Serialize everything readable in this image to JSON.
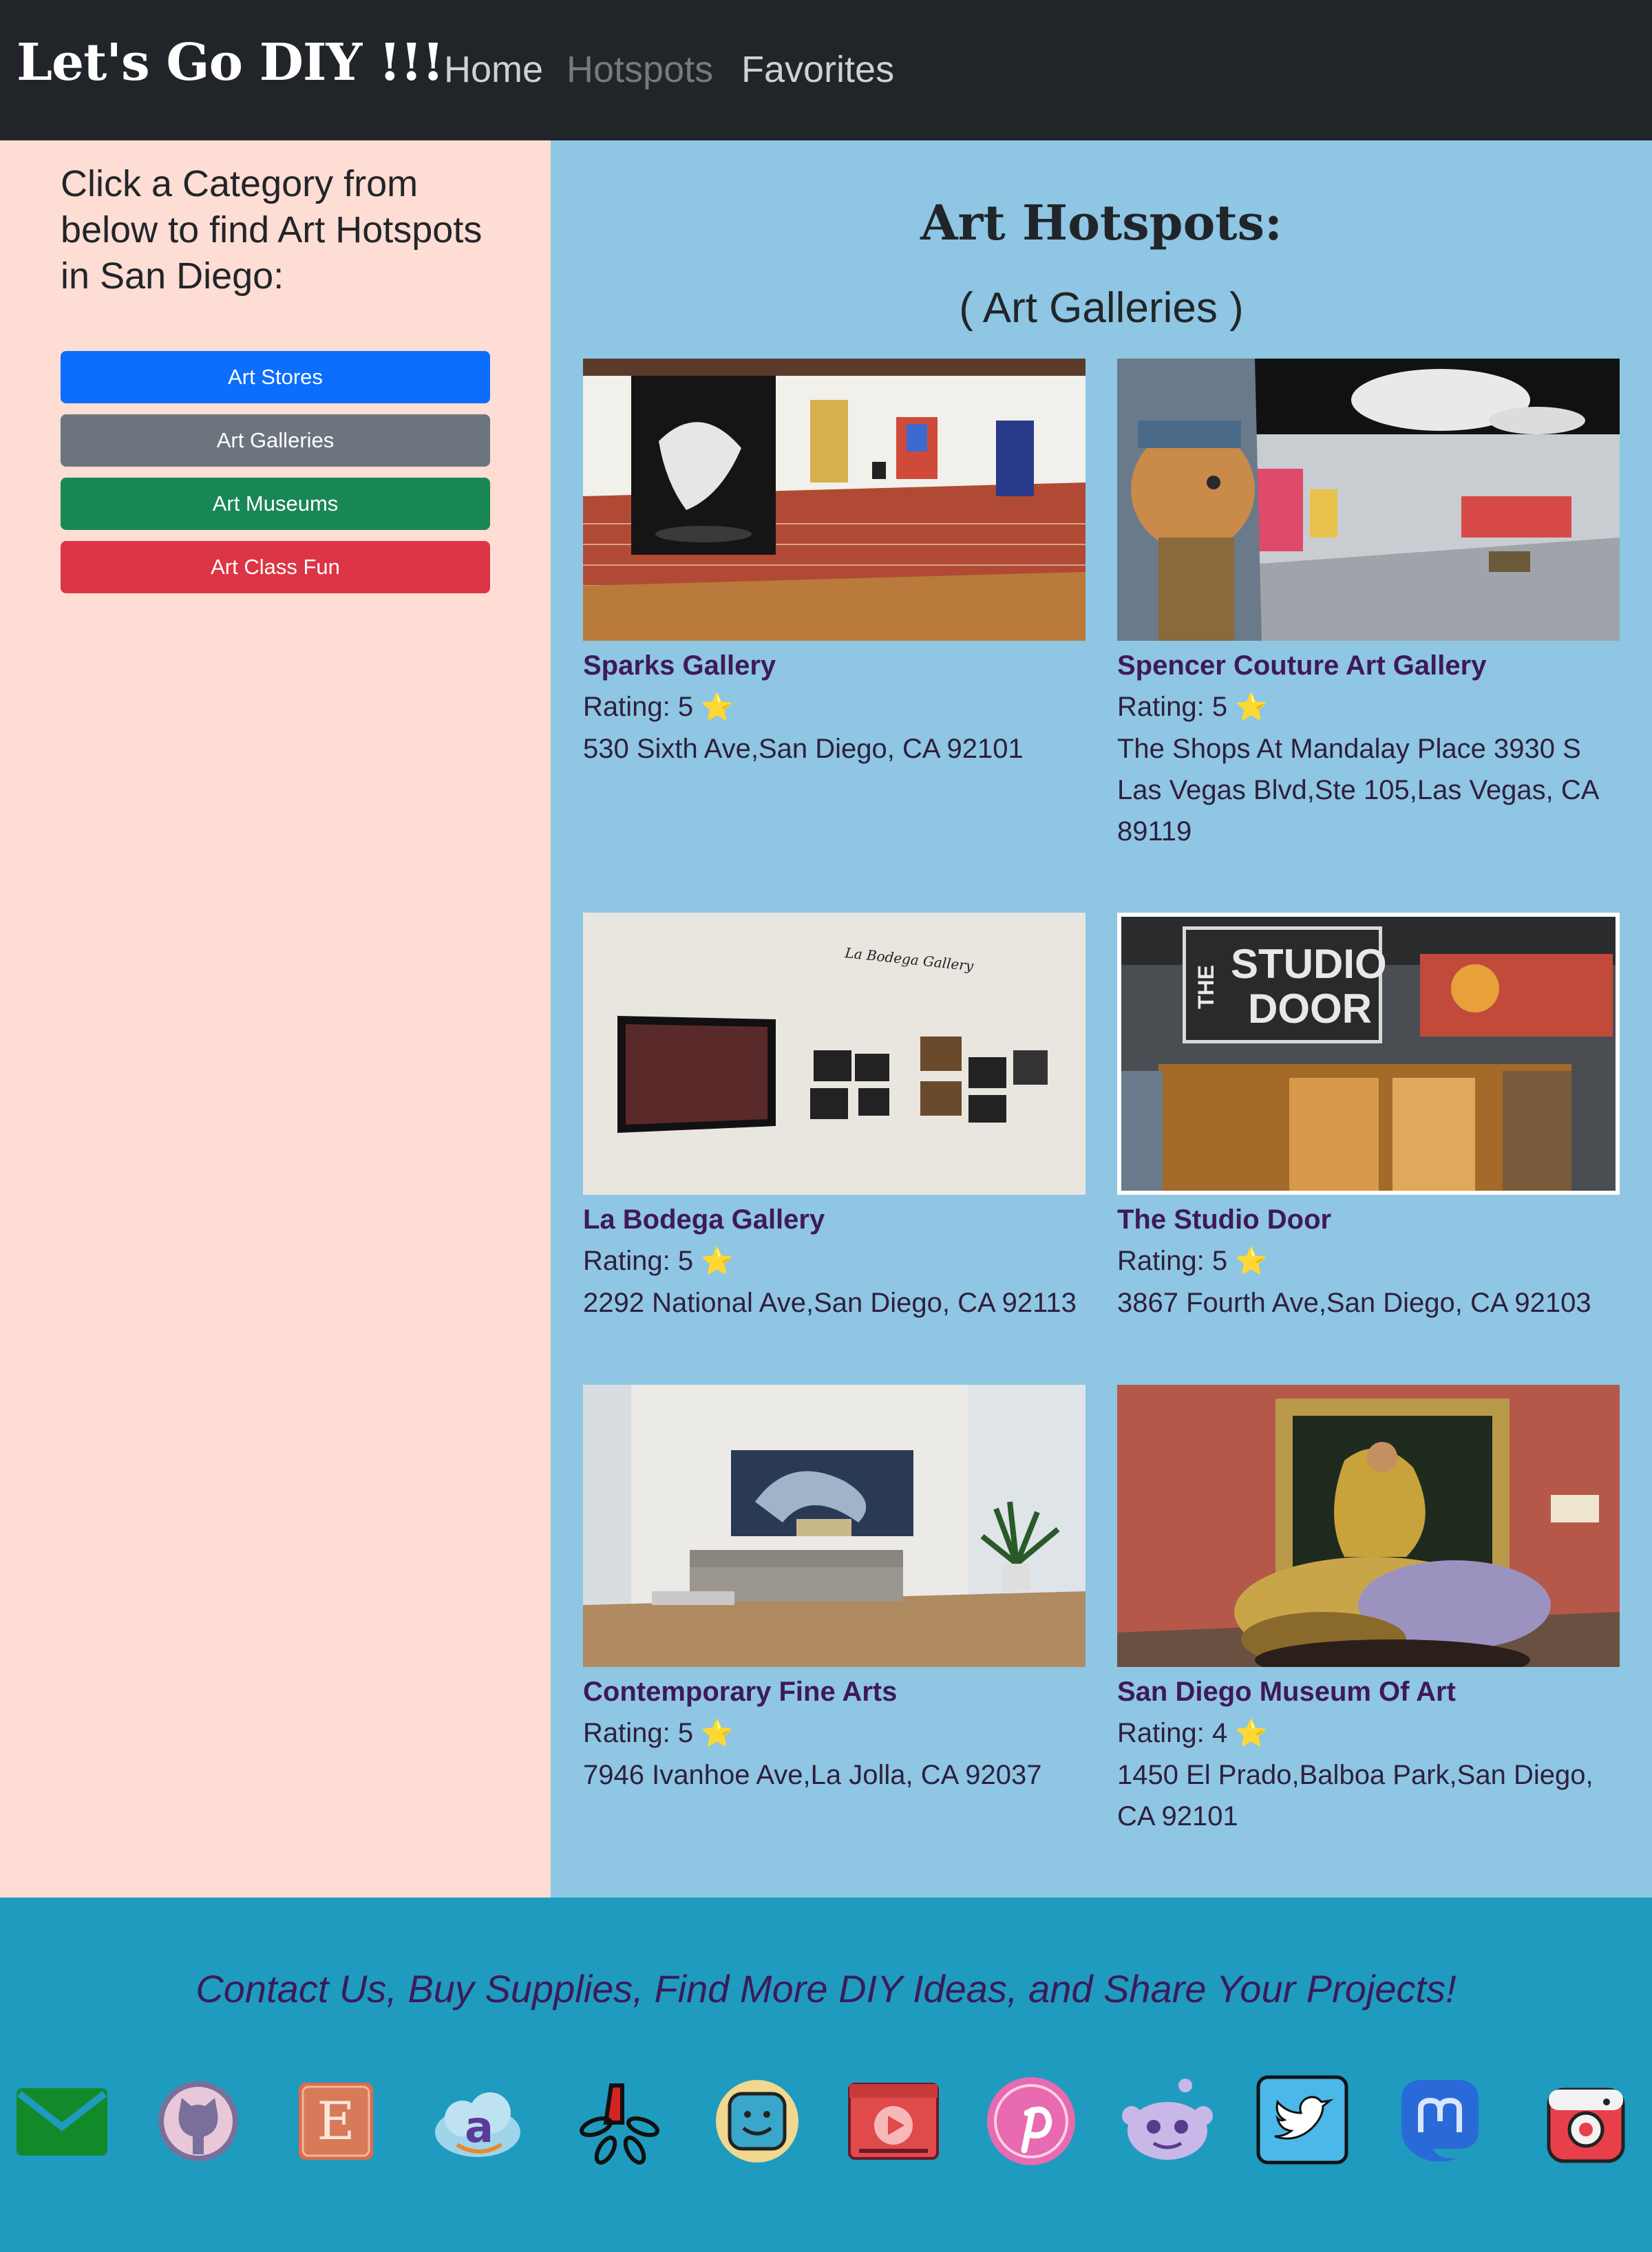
{
  "nav": {
    "brand": "Let's Go DIY !!!",
    "links": [
      "Home",
      "Hotspots",
      "Favorites"
    ]
  },
  "sidebar": {
    "heading": "Click a Category from below to find Art Hotspots in San Diego:",
    "buttons": [
      {
        "label": "Art Stores",
        "color": "#0d6efd"
      },
      {
        "label": "Art Galleries",
        "color": "#6c757d"
      },
      {
        "label": "Art Museums",
        "color": "#198754"
      },
      {
        "label": "Art Class Fun",
        "color": "#dc3545"
      }
    ]
  },
  "main": {
    "title": "Art Hotspots:",
    "subtitle": "( Art Galleries )",
    "rating_prefix": "Rating:",
    "star": "⭐",
    "cards": [
      {
        "name": "Sparks Gallery",
        "rating": "5",
        "address": "530 Sixth Ave,San Diego, CA 92101"
      },
      {
        "name": "Spencer Couture Art Gallery",
        "rating": "5",
        "address": "The Shops At Mandalay Place 3930 S Las Vegas Blvd,Ste 105,Las Vegas, CA 89119"
      },
      {
        "name": "La Bodega Gallery",
        "rating": "5",
        "address": "2292 National Ave,San Diego, CA 92113"
      },
      {
        "name": "The Studio Door",
        "rating": "5",
        "address": "3867 Fourth Ave,San Diego, CA 92103"
      },
      {
        "name": "Contemporary Fine Arts",
        "rating": "5",
        "address": "7946 Ivanhoe Ave,La Jolla, CA 92037"
      },
      {
        "name": "San Diego Museum Of Art",
        "rating": "4",
        "address": "1450 El Prado,Balboa Park,San Diego, CA 92101"
      }
    ],
    "image_text": {
      "bodega_sign": "La Bodega Gallery",
      "studio_sign_the": "THE",
      "studio_sign_studio": "STUDIO",
      "studio_sign_door": "DOOR"
    }
  },
  "footer": {
    "text": "Contact Us, Buy Supplies, Find More DIY Ideas, and Share Your Projects!",
    "icons": [
      "email-icon",
      "github-icon",
      "etsy-icon",
      "amazon-icon",
      "yelp-icon",
      "waze-icon",
      "youtube-icon",
      "pinterest-icon",
      "reddit-icon",
      "twitter-icon",
      "mastodon-icon",
      "instagram-icon"
    ],
    "icon_glyphs": {
      "etsy": "E",
      "amazon": "a"
    }
  }
}
